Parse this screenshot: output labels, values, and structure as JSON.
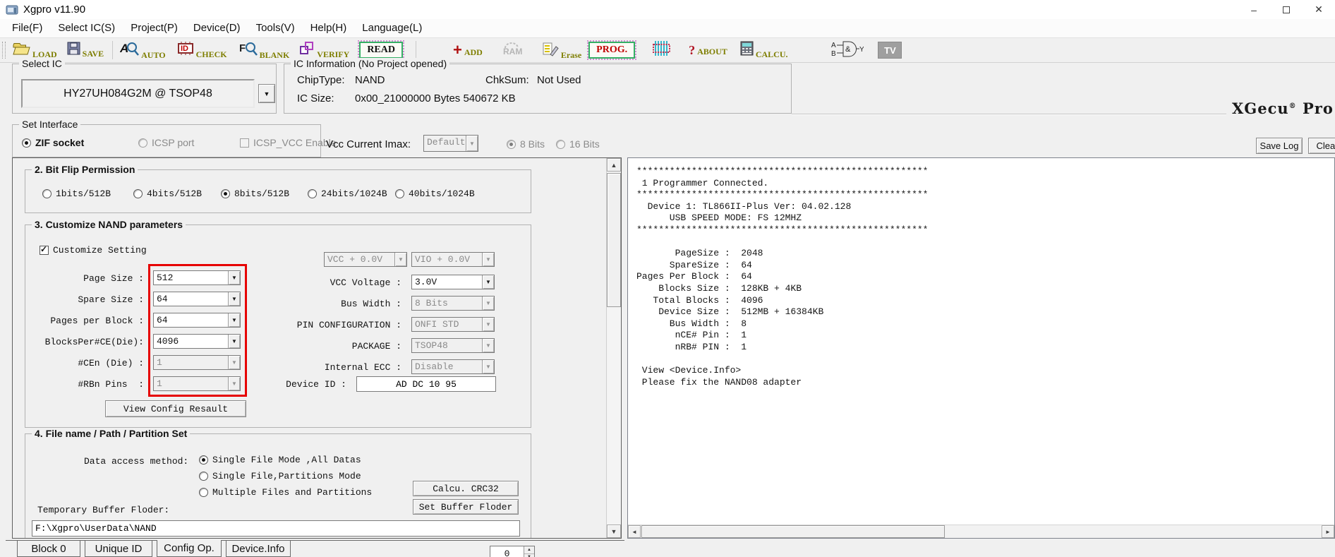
{
  "window": {
    "title": "Xgpro v11.90",
    "minimize_glyph": "–",
    "close_glyph": "✕"
  },
  "menu": {
    "items": [
      "File(F)",
      "Select IC(S)",
      "Project(P)",
      "Device(D)",
      "Tools(V)",
      "Help(H)",
      "Language(L)"
    ]
  },
  "toolbar": {
    "load": "LOAD",
    "save": "SAVE",
    "auto": "AUTO",
    "check": "CHECK",
    "blank": "BLANK",
    "verify": "VERIFY",
    "read": "READ",
    "add": "ADD",
    "ram": "RAM",
    "erase": "Erase",
    "prog": "PROG.",
    "about": "ABOUT",
    "calcu": "CALCU.",
    "tv": "TV"
  },
  "select_ic": {
    "title": "Select IC",
    "value": "HY27UH084G2M @ TSOP48"
  },
  "ic_info": {
    "title": "IC Information (No Project opened)",
    "chip_type_label": "ChipType:",
    "chip_type": "NAND",
    "chksum_label": "ChkSum:",
    "chksum": "Not Used",
    "ic_size_label": "IC Size:",
    "ic_size": "0x00_21000000 Bytes 540672 KB"
  },
  "brand": {
    "name": "XGecu",
    "reg": "®",
    "suffix": "Pro"
  },
  "set_interface": {
    "title": "Set Interface",
    "zif_socket": "ZIF socket",
    "icsp_port": "ICSP port",
    "icsp_vcc": "ICSP_VCC Enable",
    "vcc_imax_label": "Vcc Current Imax:",
    "vcc_imax_value": "Default",
    "bits8": "8 Bits",
    "bits16": "16 Bits"
  },
  "log_buttons": {
    "save_log": "Save Log",
    "clear": "Clear"
  },
  "bit_flip": {
    "title": "2. Bit Flip Permission",
    "options": [
      "1bits/512B",
      "4bits/512B",
      "8bits/512B",
      "24bits/1024B",
      "40bits/1024B"
    ],
    "selected": "8bits/512B"
  },
  "nand": {
    "title": "3. Customize NAND parameters",
    "customize_setting": "Customize Setting",
    "page_size_label": "Page Size :",
    "page_size": "512",
    "spare_size_label": "Spare Size :",
    "spare_size": "64",
    "pages_per_block_label": "Pages per Block :",
    "pages_per_block": "64",
    "blocks_per_ce_label": "BlocksPer#CE(Die):",
    "blocks_per_ce": "4096",
    "cen_die_label": "#CEn (Die) :",
    "cen_die": "1",
    "rbn_pins_label": "#RBn Pins  :",
    "rbn_pins": "1",
    "vcc_offset": "VCC + 0.0V",
    "vio_offset": "VIO + 0.0V",
    "vcc_voltage_label": "VCC Voltage :",
    "vcc_voltage": "3.0V",
    "bus_width_label": "Bus Width :",
    "bus_width": "8 Bits",
    "pin_config_label": "PIN CONFIGURATION :",
    "pin_config": "ONFI STD",
    "package_label": "PACKAGE :",
    "package": "TSOP48",
    "internal_ecc_label": "Internal ECC :",
    "internal_ecc": "Disable",
    "device_id_label": "Device ID :",
    "device_id": "AD DC 10 95",
    "view_config_button": "View Config Resault"
  },
  "file_set": {
    "title": "4. File name / Path / Partition Set",
    "data_access_label": "Data access method:",
    "options": [
      "Single File Mode ,All Datas",
      "Single File,Partitions Mode",
      "Multiple Files and Partitions"
    ],
    "selected": "Single File Mode ,All Datas",
    "calc_crc32_button": "Calcu. CRC32",
    "set_buffer_button": "Set Buffer Floder",
    "temp_buffer_label": "Temporary Buffer Floder:",
    "temp_buffer_path": "F:\\Xgpro\\UserData\\NAND"
  },
  "log": {
    "lines": [
      "*****************************************************",
      " 1 Programmer Connected.",
      "*****************************************************",
      "  Device 1: TL866II-Plus Ver: 04.02.128",
      "      USB SPEED MODE: FS 12MHZ",
      "*****************************************************",
      "",
      "       PageSize :  2048",
      "      SpareSize :  64",
      "Pages Per Block :  64",
      "    Blocks Size :  128KB + 4KB",
      "   Total Blocks :  4096",
      "    Device Size :  512MB + 16384KB",
      "      Bus Width :  8",
      "       nCE# Pin :  1",
      "       nRB# PIN :  1",
      "",
      " View <Device.Info>",
      " Please fix the NAND08 adapter"
    ]
  },
  "tabs": {
    "items": [
      "Block 0",
      "Unique ID",
      "Config Op.",
      "Device.Info"
    ],
    "selected": "Config Op.",
    "spin_value": "0"
  },
  "colors": {
    "accent_green": "#35b065",
    "prog_red": "#c00000",
    "highlight_red": "#e60000",
    "toolbar_label": "#7e7e00"
  }
}
